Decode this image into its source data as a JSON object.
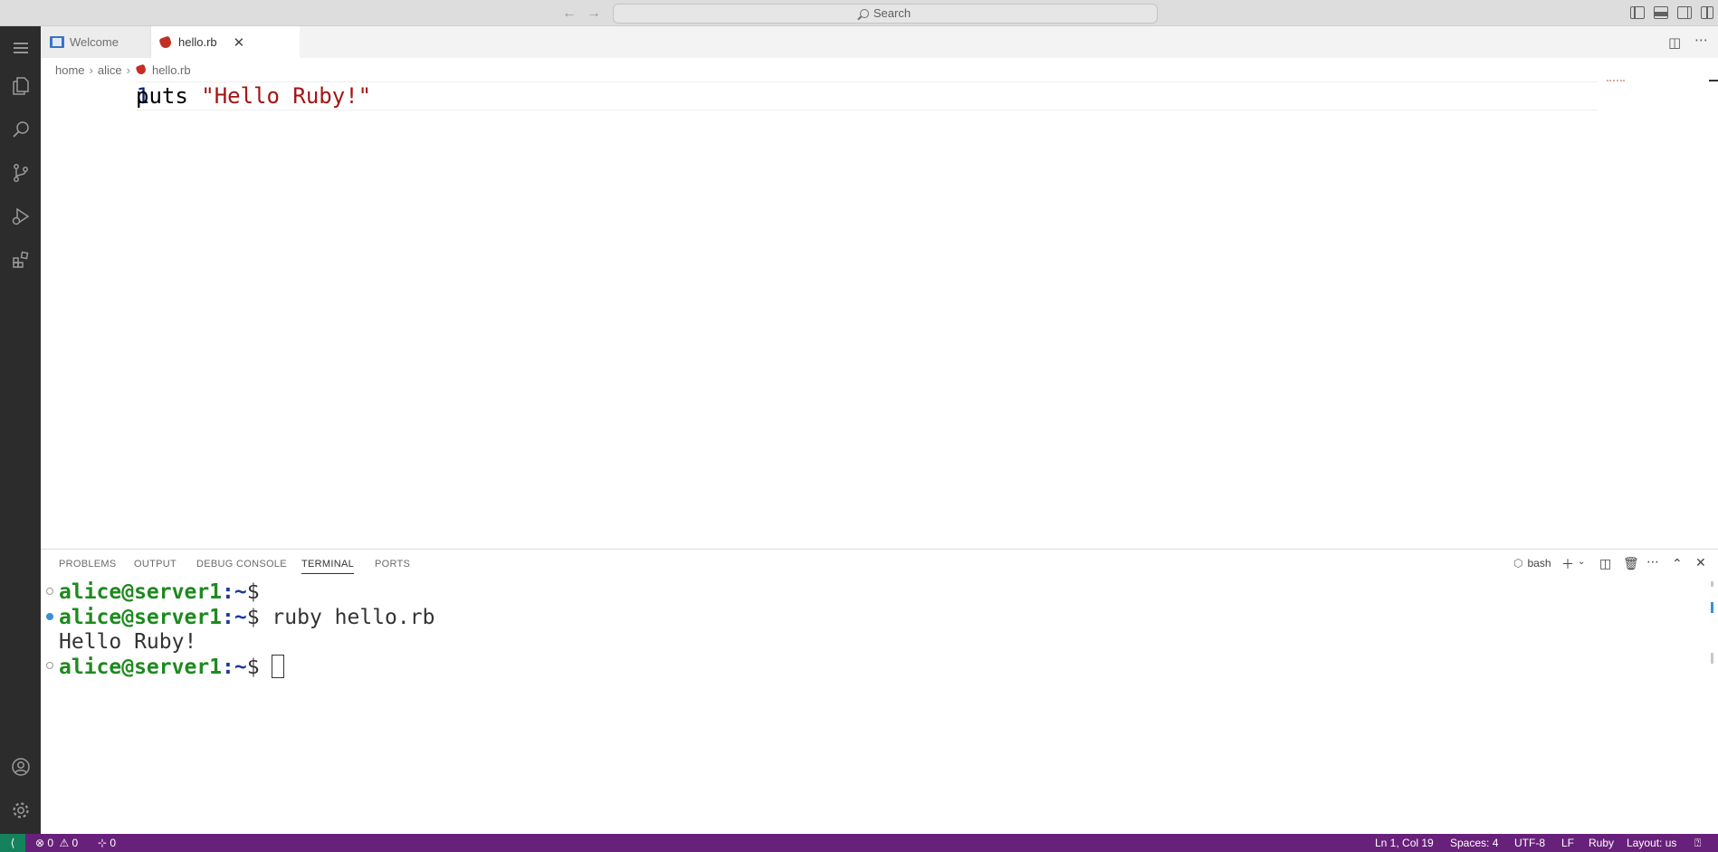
{
  "titlebar": {
    "search_placeholder": "Search",
    "back_icon": "arrow-left-icon",
    "forward_icon": "arrow-right-icon"
  },
  "activity_bar": {
    "items": [
      "explorer-icon",
      "search-icon",
      "source-control-icon",
      "run-debug-icon",
      "extensions-icon"
    ],
    "bottom": [
      "account-icon",
      "settings-gear-icon"
    ]
  },
  "tabs": [
    {
      "label": "Welcome",
      "icon": "welcome-icon",
      "active": false
    },
    {
      "label": "hello.rb",
      "icon": "ruby-file-icon",
      "active": true
    }
  ],
  "breadcrumb": {
    "parts": [
      "home",
      "alice",
      "hello.rb"
    ]
  },
  "editor": {
    "line_number": "1",
    "code_keyword": "puts ",
    "code_string": "\"Hello Ruby!\""
  },
  "panel": {
    "tabs": [
      "PROBLEMS",
      "OUTPUT",
      "DEBUG CONSOLE",
      "TERMINAL",
      "PORTS"
    ],
    "active_tab": "TERMINAL",
    "shell": "bash"
  },
  "terminal": {
    "user_host": "alice@server1",
    "path": ":~",
    "prompt": "$",
    "lines": [
      {
        "cmd": ""
      },
      {
        "cmd": " ruby hello.rb"
      },
      {
        "output": "Hello Ruby!"
      },
      {
        "cmd": " "
      }
    ]
  },
  "statusbar": {
    "errors": "0",
    "warnings": "0",
    "ports": "0",
    "position": "Ln 1, Col 19",
    "spaces": "Spaces: 4",
    "encoding": "UTF-8",
    "eol": "LF",
    "language": "Ruby",
    "layout": "Layout: us"
  },
  "colors": {
    "statusbar_bg": "#68217a",
    "remote_bg": "#16825d",
    "activity_bg": "#2c2c2c",
    "string": "#a31515",
    "terminal_user": "#1e8a1e",
    "terminal_path": "#1d3aa0"
  }
}
